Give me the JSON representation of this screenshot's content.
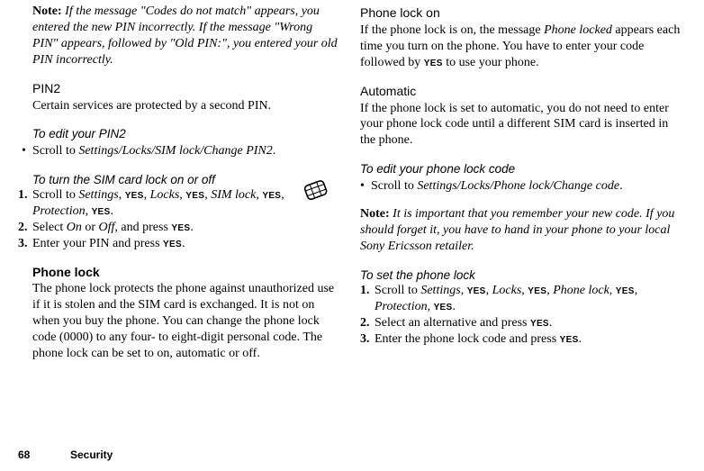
{
  "yes": "YES",
  "left": {
    "note_label": "Note:",
    "note_body": "If the message \"Codes do not match\" appears, you entered the new PIN incorrectly. If the message \"Wrong PIN\" appears, followed by \"Old PIN:\", you entered your old PIN incorrectly.",
    "pin2_h": "PIN2",
    "pin2_body": "Certain services are protected by a second PIN.",
    "edit_pin2_h": "To edit your PIN2",
    "edit_pin2_bullet_pre": "Scroll to ",
    "edit_pin2_path": "Settings/Locks/SIM lock/Change PIN2",
    "sim_h": "To turn the SIM card lock on or off",
    "sim1_pre": "Scroll to ",
    "sim1_settings": "Settings",
    "sim1_locks": "Locks",
    "sim1_simlock": "SIM lock",
    "sim1_protection": "Protection",
    "sim2_pre": "Select ",
    "sim2_on": "On",
    "sim2_or": " or ",
    "sim2_off": "Off",
    "sim2_post": ", and press ",
    "sim3_pre": "Enter your PIN and press ",
    "plock_h": "Phone lock",
    "plock_body": "The phone lock protects the phone against unauthorized use if it is stolen and the SIM card is exchanged. It is not on when you buy the phone. You can change the phone lock code (0000) to any four- to eight-digit personal code. The phone lock can be set to on, automatic or off."
  },
  "right": {
    "plon_h": "Phone lock on",
    "plon_pre": "If the phone lock is on, the message ",
    "plon_msg": "Phone locked",
    "plon_mid": " appears each time you turn on the phone. You have to enter your code followed by ",
    "plon_post": " to use your phone.",
    "auto_h": "Automatic",
    "auto_body": "If the phone lock is set to automatic, you do not need to enter your phone lock code until a different SIM card is inserted in the phone.",
    "edit_code_h": "To edit your phone lock code",
    "edit_code_pre": "Scroll to ",
    "edit_code_path": "Settings/Locks/Phone lock/Change code",
    "note2_label": "Note:",
    "note2_body": "It is important that you remember your new code. If you should forget it, you have to hand in your phone to your local Sony Ericsson retailer.",
    "set_h": "To set the phone lock",
    "set1_pre": "Scroll to ",
    "set1_settings": "Settings",
    "set1_locks": "Locks",
    "set1_plock": "Phone lock",
    "set1_protection": "Protection",
    "set2_pre": "Select an alternative and press ",
    "set3_pre": "Enter the phone lock code and press "
  },
  "footer": {
    "page": "68",
    "section": "Security"
  }
}
